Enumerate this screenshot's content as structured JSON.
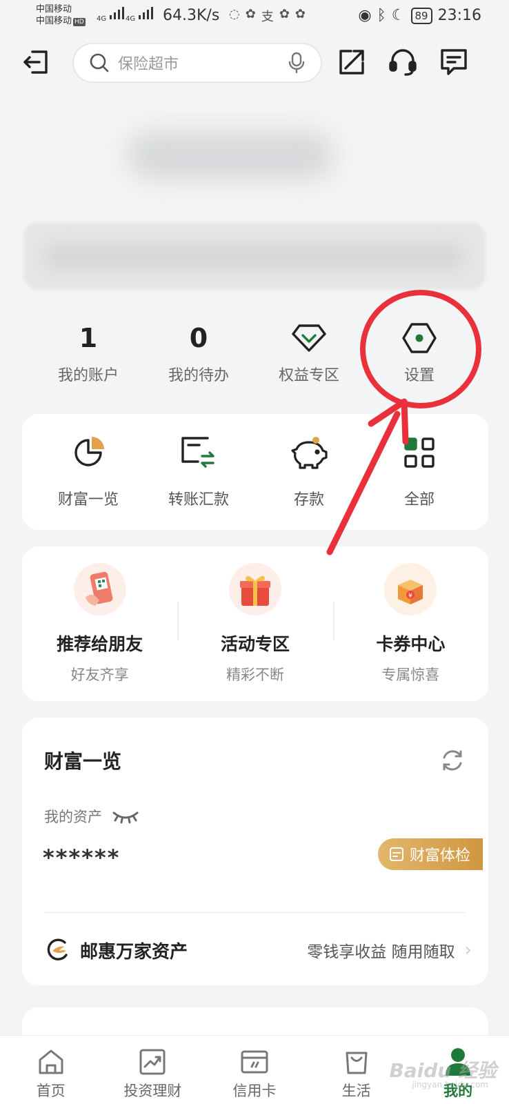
{
  "status_bar": {
    "carrier1": "中国移动",
    "carrier2": "中国移动",
    "hd": "HD",
    "net1": "4G",
    "net2": "4G",
    "speed": "64.3K/s",
    "battery": "89",
    "time": "23:16"
  },
  "header": {
    "search_placeholder": "保险超市"
  },
  "quick_row": {
    "accounts_count": "1",
    "accounts_label": "我的账户",
    "todo_count": "0",
    "todo_label": "我的待办",
    "benefits_label": "权益专区",
    "settings_label": "设置"
  },
  "services": [
    {
      "label": "财富一览"
    },
    {
      "label": "转账汇款"
    },
    {
      "label": "存款"
    },
    {
      "label": "全部"
    }
  ],
  "promos": [
    {
      "title": "推荐给朋友",
      "sub": "好友齐享"
    },
    {
      "title": "活动专区",
      "sub": "精彩不断"
    },
    {
      "title": "卡券中心",
      "sub": "专属惊喜"
    }
  ],
  "wealth": {
    "title": "财富一览",
    "assets_label": "我的资产",
    "assets_value": "******",
    "checkup_label": "财富体检",
    "product_name": "邮惠万家资产",
    "product_desc": "零钱享收益 随用随取"
  },
  "tabs": [
    {
      "label": "首页"
    },
    {
      "label": "投资理财"
    },
    {
      "label": "信用卡"
    },
    {
      "label": "生活"
    },
    {
      "label": "我的"
    }
  ],
  "colors": {
    "accent": "#1f7a3a",
    "annotation": "#e8313a",
    "gold": "#d09640"
  }
}
